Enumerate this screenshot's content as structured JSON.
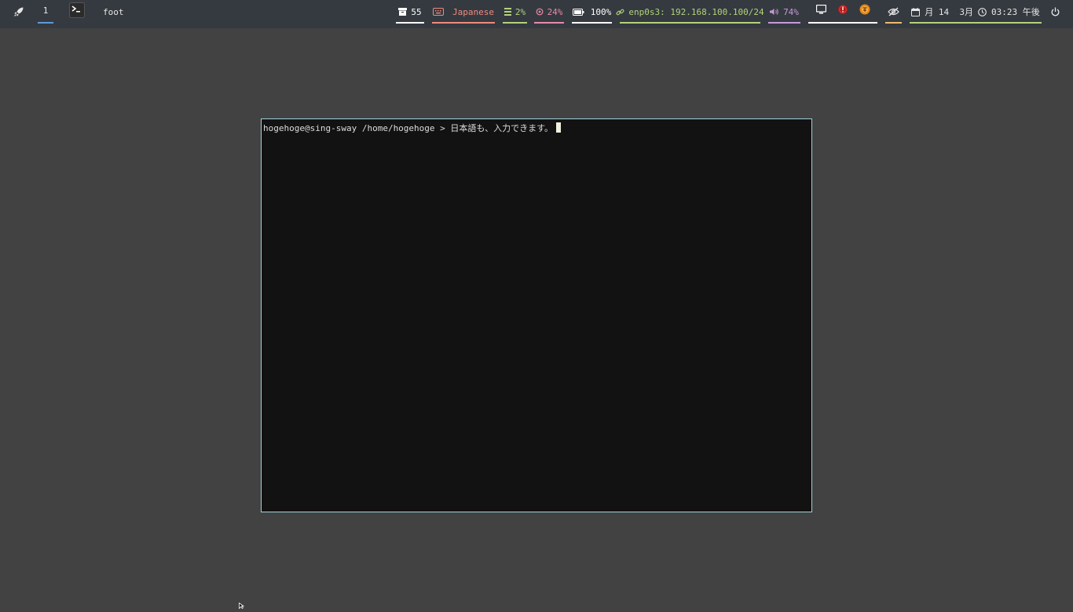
{
  "taskbar": {
    "launcher_icon": "rocket-icon",
    "workspace": "1",
    "app_icon": "terminal-icon",
    "window_title": "foot"
  },
  "status": {
    "updates": {
      "icon": "package-icon",
      "value": "55",
      "color": "#ffffff"
    },
    "keyboard": {
      "icon": "keyboard-icon",
      "value": "Japanese",
      "color": "#f08a7e"
    },
    "cpu": {
      "icon": "cpu-icon",
      "value": "2%",
      "color": "#b4d27a"
    },
    "memory": {
      "icon": "memory-icon",
      "value": "24%",
      "color": "#e88aa8"
    },
    "battery": {
      "icon": "battery-icon",
      "value": "100%",
      "color": "#ffffff"
    },
    "network": {
      "icon": "link-icon",
      "value": "enp0s3: 192.168.100.100/24",
      "color": "#b4d27a"
    },
    "volume": {
      "icon": "speaker-icon",
      "value": "74%",
      "color": "#c79ad9"
    },
    "tray": [
      "display-icon",
      "red-alert-icon",
      "orange-app-icon"
    ],
    "idle_inhibitor": {
      "icon": "eye-off-icon",
      "color": "#f0b86c"
    },
    "clock": {
      "calendar_icon": "calendar-icon",
      "date": "月 14  3月",
      "clock_icon": "clock-icon",
      "time": "03:23 午後",
      "color": "#b4d27a"
    },
    "power_icon": "power-icon"
  },
  "terminal": {
    "prompt": "hogehoge@sing-sway /home/hogehoge > ",
    "input": "日本語も、入力できます。"
  }
}
